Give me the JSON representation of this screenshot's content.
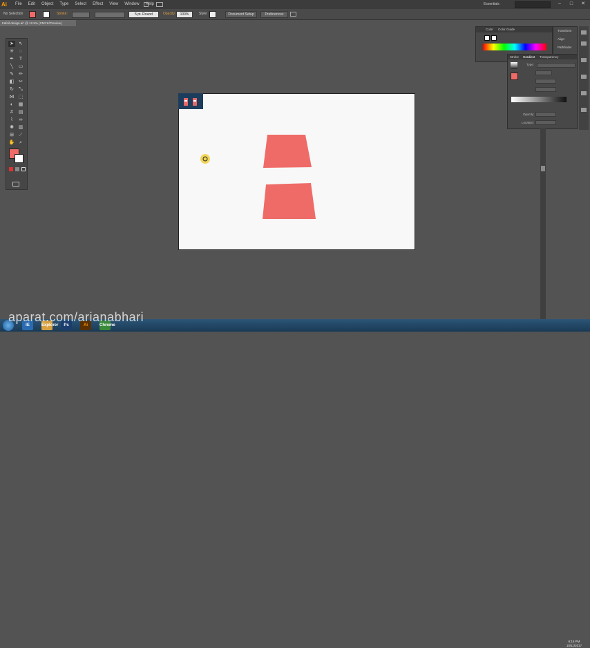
{
  "app": {
    "logo": "Ai",
    "menus": [
      "File",
      "Edit",
      "Object",
      "Type",
      "Select",
      "Effect",
      "View",
      "Window",
      "Help"
    ],
    "workspace": "Essentials"
  },
  "control_bar": {
    "selection": "No Selection",
    "stroke_label": "Stroke:",
    "brush": "5 pt. Round",
    "opacity_label": "Opacity:",
    "opacity": "100%",
    "style_label": "Style:",
    "document_setup": "Document Setup",
    "preferences": "Preferences"
  },
  "document": {
    "tab": "trafoil design.ai* @ 12.5% (CMYK/Preview)"
  },
  "colors": {
    "fill": "#ef6b67",
    "artboard": "#f8f8f8",
    "pasteboard": "#535353"
  },
  "panels": {
    "color_tabs": [
      "Color",
      "Color Guide"
    ],
    "side_tabs": [
      "Transform",
      "Align",
      "Pathfinder"
    ],
    "gradient_tabs": [
      "Stroke",
      "Gradient",
      "Transparency"
    ],
    "gradient_type_label": "Type:",
    "gradient_rows": [
      "Opacity:",
      "Location:"
    ]
  },
  "taskbar": {
    "apps": [
      "IE",
      "Explorer",
      "Ps",
      "Ai",
      "Chrome"
    ],
    "time": "6:15 PM",
    "date": "10/11/2017"
  },
  "watermark": "aparat.com/arianabhari"
}
